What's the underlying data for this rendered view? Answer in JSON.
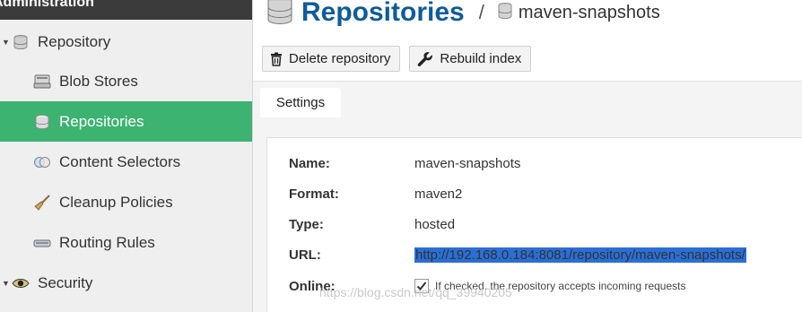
{
  "sidebar": {
    "header": "Administration",
    "items": [
      {
        "label": "Repository",
        "icon": "database-icon"
      },
      {
        "label": "Blob Stores",
        "icon": "blob-store-icon"
      },
      {
        "label": "Repositories",
        "icon": "database-icon"
      },
      {
        "label": "Content Selectors",
        "icon": "content-selector-icon"
      },
      {
        "label": "Cleanup Policies",
        "icon": "broom-icon"
      },
      {
        "label": "Routing Rules",
        "icon": "routing-rule-icon"
      },
      {
        "label": "Security",
        "icon": "security-eye-icon"
      }
    ]
  },
  "header": {
    "title": "Repositories",
    "separator": "/",
    "breadcrumb": "maven-snapshots"
  },
  "toolbar": {
    "delete_label": "Delete repository",
    "rebuild_label": "Rebuild index"
  },
  "tabs": [
    {
      "label": "Settings",
      "active": true
    }
  ],
  "settings": {
    "name_label": "Name:",
    "name_value": "maven-snapshots",
    "format_label": "Format:",
    "format_value": "maven2",
    "type_label": "Type:",
    "type_value": "hosted",
    "url_label": "URL:",
    "url_value": "http://192.168.0.184:8081/repository/maven-snapshots/",
    "online_label": "Online:",
    "online_checked": true,
    "online_help": "If checked, the repository accepts incoming requests"
  },
  "watermark": "https://blog.csdn.net/qq_39940205",
  "colors": {
    "active_item": "#3cb371",
    "title_blue": "#0d5c9c",
    "selection": "#2a6fd6"
  }
}
